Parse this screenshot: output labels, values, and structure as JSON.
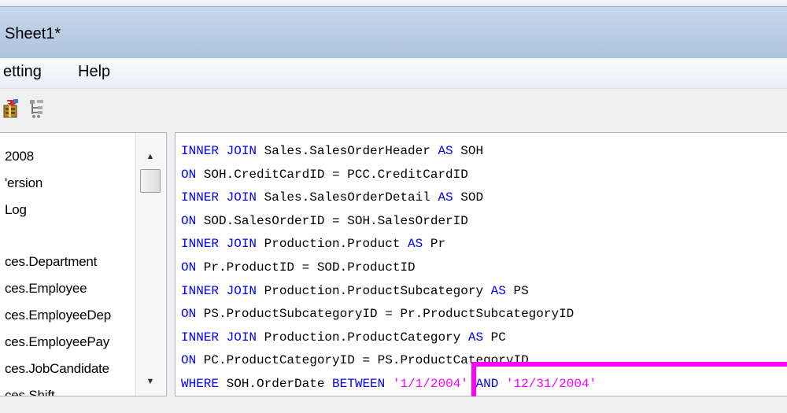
{
  "window": {
    "title": "Sheet1*"
  },
  "menu": {
    "items": [
      {
        "label": "etting"
      },
      {
        "label": "Help"
      }
    ]
  },
  "toolbar": {
    "icons": [
      "package-run-icon",
      "tree-structure-icon"
    ]
  },
  "object_list": {
    "items": [
      {
        "label": "2008"
      },
      {
        "label": "'ersion"
      },
      {
        "label": "Log"
      },
      {
        "label": "ces.Department"
      },
      {
        "label": "ces.Employee"
      },
      {
        "label": "ces.EmployeeDep"
      },
      {
        "label": "ces.EmployeePay"
      },
      {
        "label": "ces.JobCandidate"
      },
      {
        "label": "ces.Shift"
      }
    ]
  },
  "sql_editor": {
    "colors": {
      "keyword": "#0000ff",
      "string": "#ff00ff",
      "identifier": "#000000"
    },
    "lines": [
      [
        {
          "t": "INNER JOIN",
          "c": "kw"
        },
        {
          "t": " Sales.SalesOrderHeader ",
          "c": "id"
        },
        {
          "t": "AS",
          "c": "kw"
        },
        {
          "t": " SOH",
          "c": "id"
        }
      ],
      [
        {
          "t": "ON",
          "c": "kw"
        },
        {
          "t": " SOH.CreditCardID = PCC.CreditCardID",
          "c": "id"
        }
      ],
      [
        {
          "t": "INNER JOIN",
          "c": "kw"
        },
        {
          "t": " Sales.SalesOrderDetail ",
          "c": "id"
        },
        {
          "t": "AS",
          "c": "kw"
        },
        {
          "t": " SOD",
          "c": "id"
        }
      ],
      [
        {
          "t": "ON",
          "c": "kw"
        },
        {
          "t": " SOD.SalesOrderID = SOH.SalesOrderID",
          "c": "id"
        }
      ],
      [
        {
          "t": "INNER JOIN",
          "c": "kw"
        },
        {
          "t": " Production.Product ",
          "c": "id"
        },
        {
          "t": "AS",
          "c": "kw"
        },
        {
          "t": " Pr",
          "c": "id"
        }
      ],
      [
        {
          "t": "ON",
          "c": "kw"
        },
        {
          "t": " Pr.ProductID = SOD.ProductID",
          "c": "id"
        }
      ],
      [
        {
          "t": "INNER JOIN",
          "c": "kw"
        },
        {
          "t": " Production.ProductSubcategory ",
          "c": "id"
        },
        {
          "t": "AS",
          "c": "kw"
        },
        {
          "t": " PS",
          "c": "id"
        }
      ],
      [
        {
          "t": "ON",
          "c": "kw"
        },
        {
          "t": " PS.ProductSubcategoryID = Pr.ProductSubcategoryID",
          "c": "id"
        }
      ],
      [
        {
          "t": "INNER JOIN",
          "c": "kw"
        },
        {
          "t": " Production.ProductCategory ",
          "c": "id"
        },
        {
          "t": "AS",
          "c": "kw"
        },
        {
          "t": " PC",
          "c": "id"
        }
      ],
      [
        {
          "t": "ON",
          "c": "kw"
        },
        {
          "t": " PC.ProductCategoryID = PS.ProductCategoryID",
          "c": "id"
        }
      ],
      [
        {
          "t": "WHERE",
          "c": "kw"
        },
        {
          "t": " SOH.OrderDate ",
          "c": "id"
        },
        {
          "t": "BETWEEN",
          "c": "kw"
        },
        {
          "t": " ",
          "c": "id"
        },
        {
          "t": "'1/1/2004'",
          "c": "str"
        },
        {
          "t": " ",
          "c": "id"
        },
        {
          "t": "AND",
          "c": "kw"
        },
        {
          "t": " ",
          "c": "id"
        },
        {
          "t": "'12/31/2004'",
          "c": "str"
        }
      ]
    ]
  },
  "highlight": {
    "color": "#ff00ff"
  }
}
